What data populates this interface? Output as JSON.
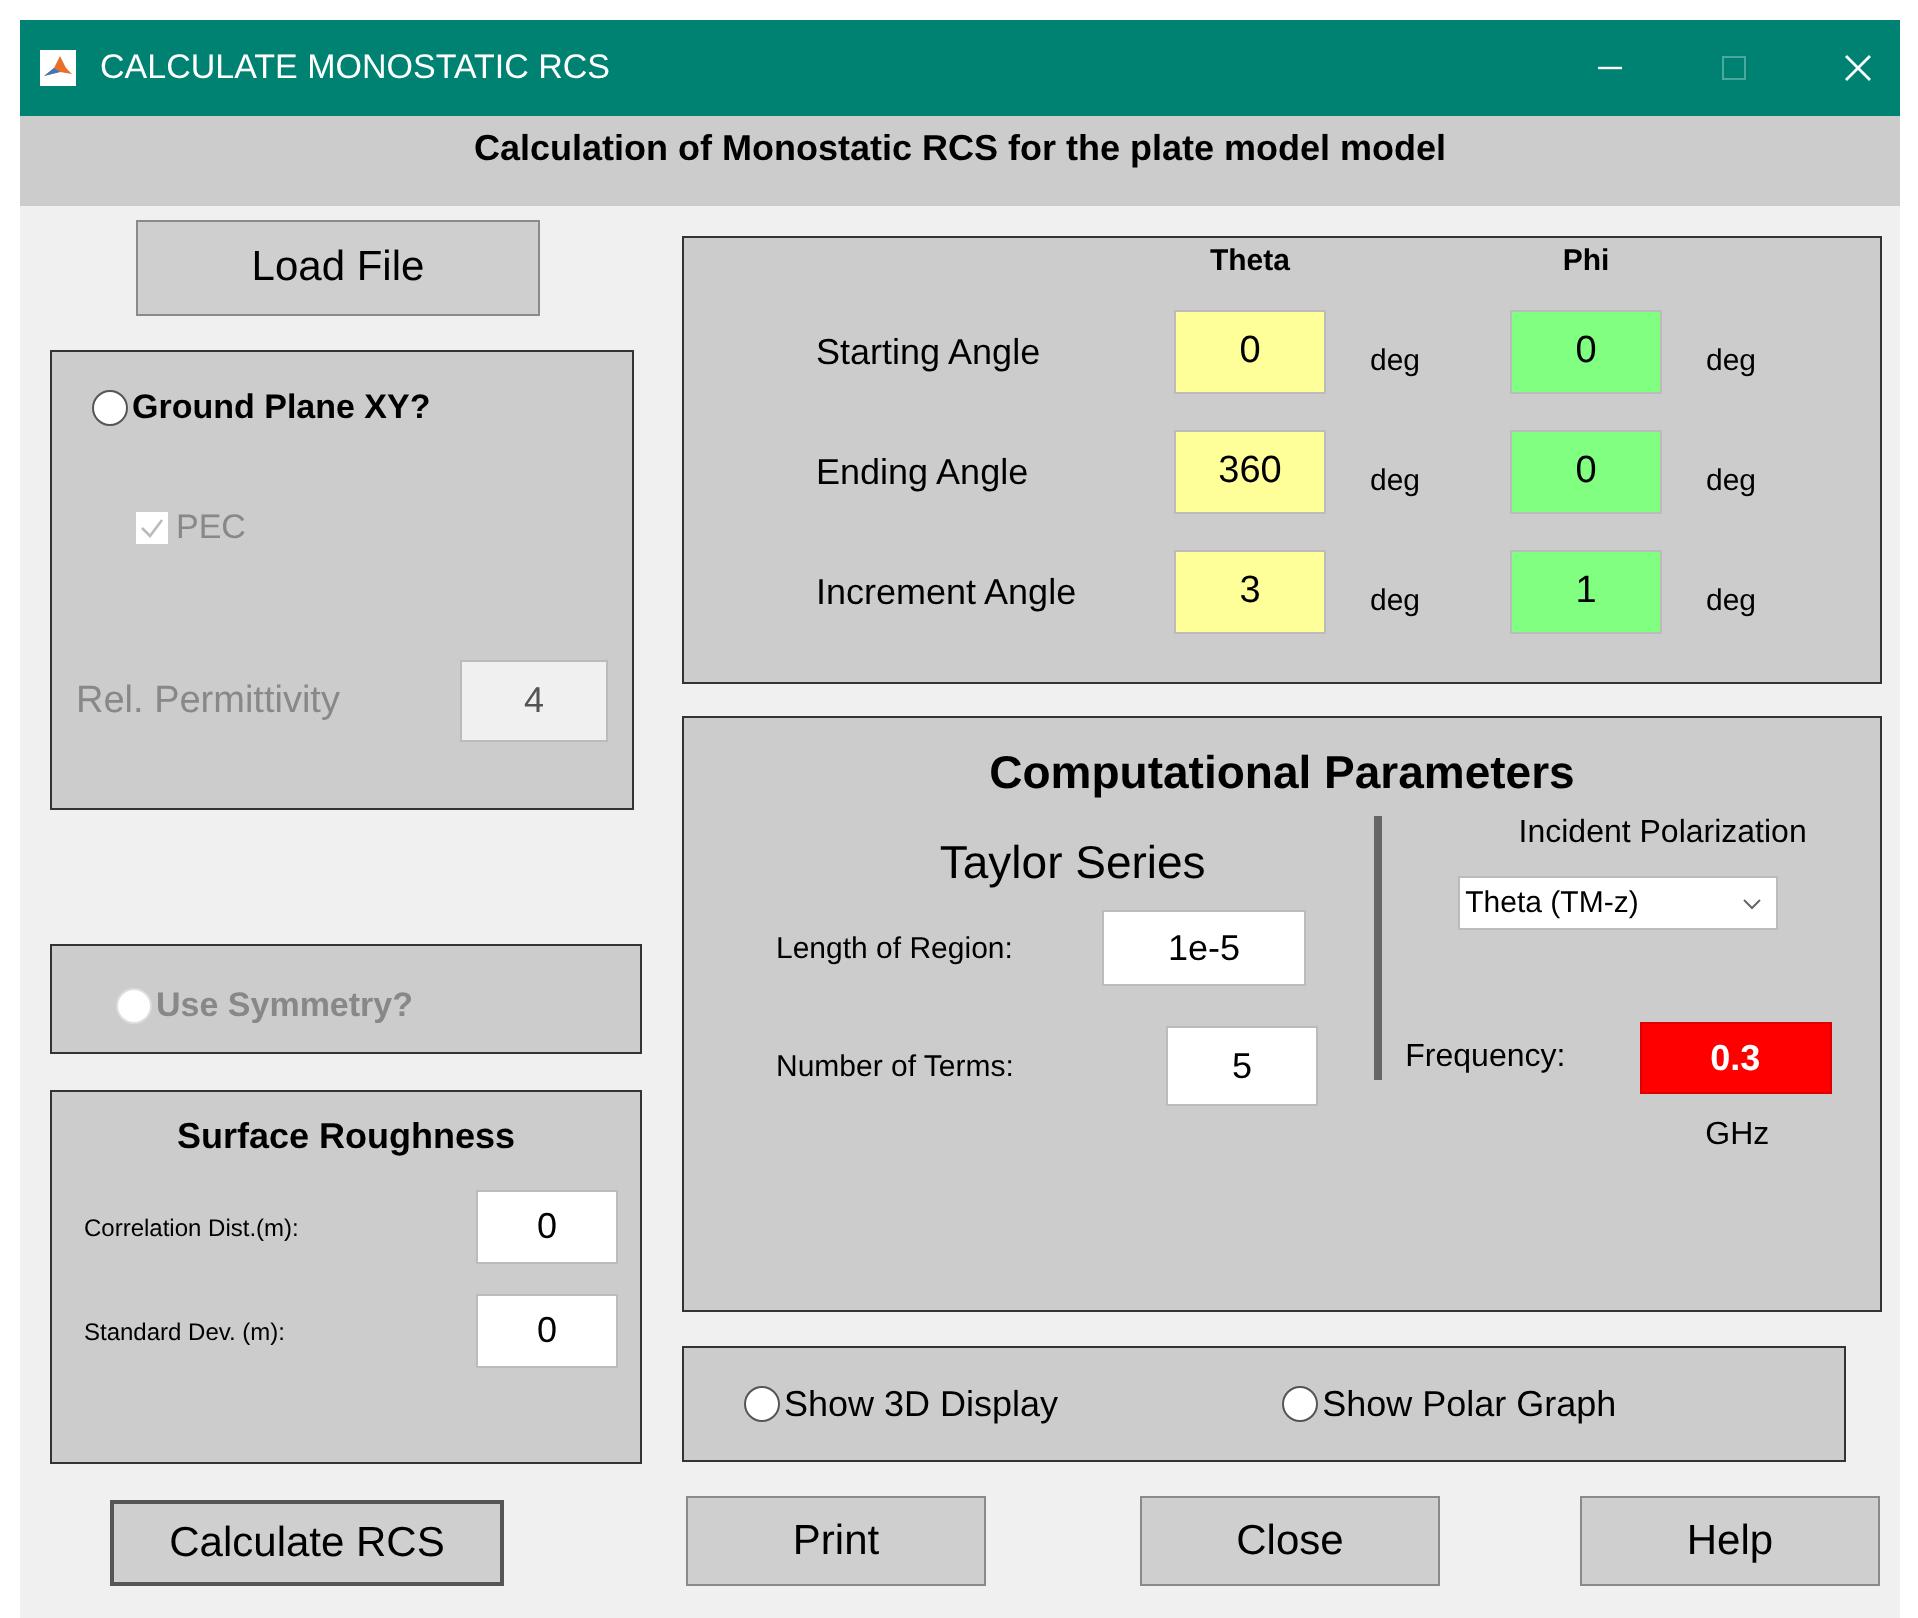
{
  "window": {
    "title": "CALCULATE MONOSTATIC RCS"
  },
  "header": "Calculation of Monostatic RCS for the plate model model",
  "load_button": "Load File",
  "ground_plane": {
    "label": "Ground Plane XY?",
    "selected": false,
    "pec": {
      "label": "PEC",
      "checked": true,
      "disabled": true
    },
    "permittivity": {
      "label": "Rel. Permittivity",
      "value": "4",
      "disabled": true
    }
  },
  "symmetry": {
    "label": "Use Symmetry?",
    "selected": false,
    "disabled": true
  },
  "surface_roughness": {
    "title": "Surface Roughness",
    "fields": [
      {
        "label": "Correlation Dist.(m):",
        "value": "0"
      },
      {
        "label": "Standard Dev. (m):",
        "value": "0"
      }
    ]
  },
  "angles": {
    "columns": [
      "Theta",
      "Phi"
    ],
    "rows": [
      {
        "label": "Starting Angle",
        "theta": "0",
        "theta_unit": "deg",
        "phi": "0",
        "phi_unit": "deg"
      },
      {
        "label": "Ending Angle",
        "theta": "360",
        "theta_unit": "deg",
        "phi": "0",
        "phi_unit": "deg"
      },
      {
        "label": "Increment Angle",
        "theta": "3",
        "theta_unit": "deg",
        "phi": "1",
        "phi_unit": "deg"
      }
    ]
  },
  "computational": {
    "title": "Computational Parameters",
    "taylor": {
      "title": "Taylor Series",
      "fields": [
        {
          "label": "Length of Region:",
          "value": "1e-5"
        },
        {
          "label": "Number of Terms:",
          "value": "5"
        }
      ]
    },
    "polarization": {
      "label": "Incident Polarization",
      "value": "Theta (TM-z)"
    },
    "frequency": {
      "label": "Frequency:",
      "value": "0.3",
      "unit": "GHz"
    }
  },
  "display_options": [
    {
      "label": "Show 3D Display",
      "selected": false
    },
    {
      "label": "Show Polar Graph",
      "selected": false
    }
  ],
  "buttons": [
    "Calculate RCS",
    "Print",
    "Close",
    "Help"
  ]
}
